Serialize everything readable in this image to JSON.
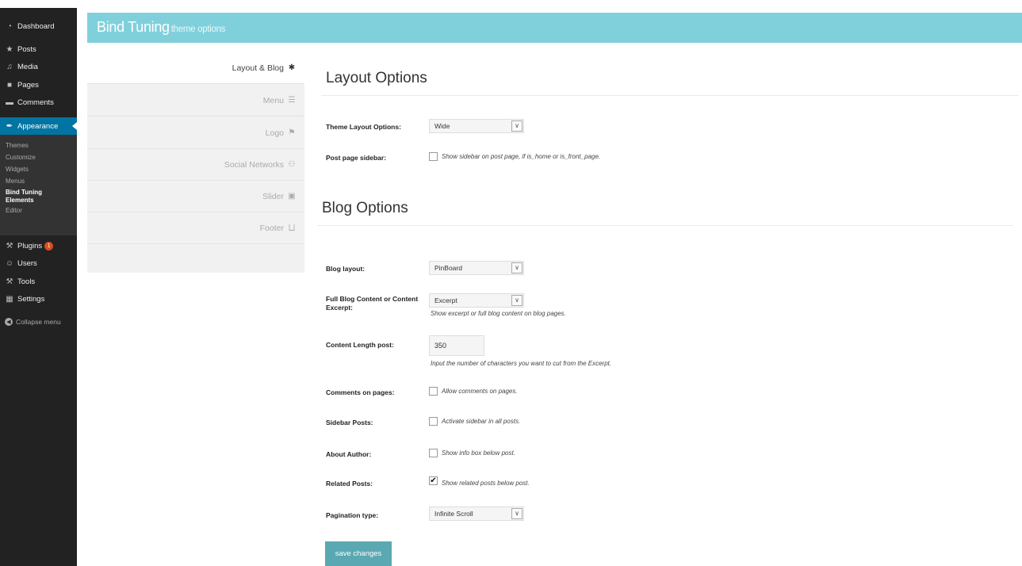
{
  "sidebar": {
    "items": [
      {
        "icon": "dashboard-icon",
        "glyph": "◔",
        "label": "Dashboard"
      },
      {
        "icon": "posts-icon",
        "glyph": "★",
        "label": "Posts"
      },
      {
        "icon": "media-icon",
        "glyph": "♫",
        "label": "Media"
      },
      {
        "icon": "pages-icon",
        "glyph": "■",
        "label": "Pages"
      },
      {
        "icon": "comments-icon",
        "glyph": "▬",
        "label": "Comments"
      },
      {
        "icon": "appearance-icon",
        "glyph": "✒",
        "label": "Appearance"
      }
    ],
    "appearance_sub": [
      "Themes",
      "Customize",
      "Widgets",
      "Menus",
      "Bind Tuning Elements",
      "Editor"
    ],
    "items2": [
      {
        "icon": "plugins-icon",
        "glyph": "⚒",
        "label": "Plugins",
        "badge": "1"
      },
      {
        "icon": "users-icon",
        "glyph": "☺",
        "label": "Users"
      },
      {
        "icon": "tools-icon",
        "glyph": "⚒",
        "label": "Tools"
      },
      {
        "icon": "settings-icon",
        "glyph": "▦",
        "label": "Settings"
      }
    ],
    "collapse": "Collapse menu"
  },
  "header": {
    "title": "Bind Tuning",
    "subtitle": "theme options"
  },
  "tabs": [
    {
      "label": "Layout & Blog",
      "icon": "gear-icon",
      "glyph": "✱"
    },
    {
      "label": "Menu",
      "icon": "menu-icon",
      "glyph": "☰"
    },
    {
      "label": "Logo",
      "icon": "flag-icon",
      "glyph": "⚑"
    },
    {
      "label": "Social Networks",
      "icon": "group-icon",
      "glyph": "⚇"
    },
    {
      "label": "Slider",
      "icon": "image-icon",
      "glyph": "▣"
    },
    {
      "label": "Footer",
      "icon": "footer-icon",
      "glyph": "⨆"
    }
  ],
  "layout": {
    "title": "Layout Options",
    "theme_layout_label": "Theme Layout Options:",
    "theme_layout_value": "Wide",
    "post_sidebar_label": "Post page sidebar:",
    "post_sidebar_text": "Show sidebar on post page, if is_home or is_front_page."
  },
  "blog": {
    "title": "Blog Options",
    "layout_label": "Blog layout:",
    "layout_value": "PinBoard",
    "content_label": "Full Blog Content or Content Excerpt:",
    "content_value": "Excerpt",
    "content_help": "Show excerpt or full blog content on blog pages.",
    "length_label": "Content Length post:",
    "length_value": "350",
    "length_help": "Input the number of characters you want to cut from the Excerpt.",
    "comments_label": "Comments on pages:",
    "comments_text": "Allow comments on pages.",
    "sidebar_label": "Sidebar Posts:",
    "sidebar_text": "Activate sidebar in all posts.",
    "author_label": "About Author:",
    "author_text": "Show info box below post.",
    "related_label": "Related Posts:",
    "related_text": "Show related posts below post.",
    "related_checked": true,
    "pagination_label": "Pagination type:",
    "pagination_value": "Infinite Scroll"
  },
  "save_label": "save changes",
  "dropdown_glyph": "∨",
  "check_glyph": "✔"
}
